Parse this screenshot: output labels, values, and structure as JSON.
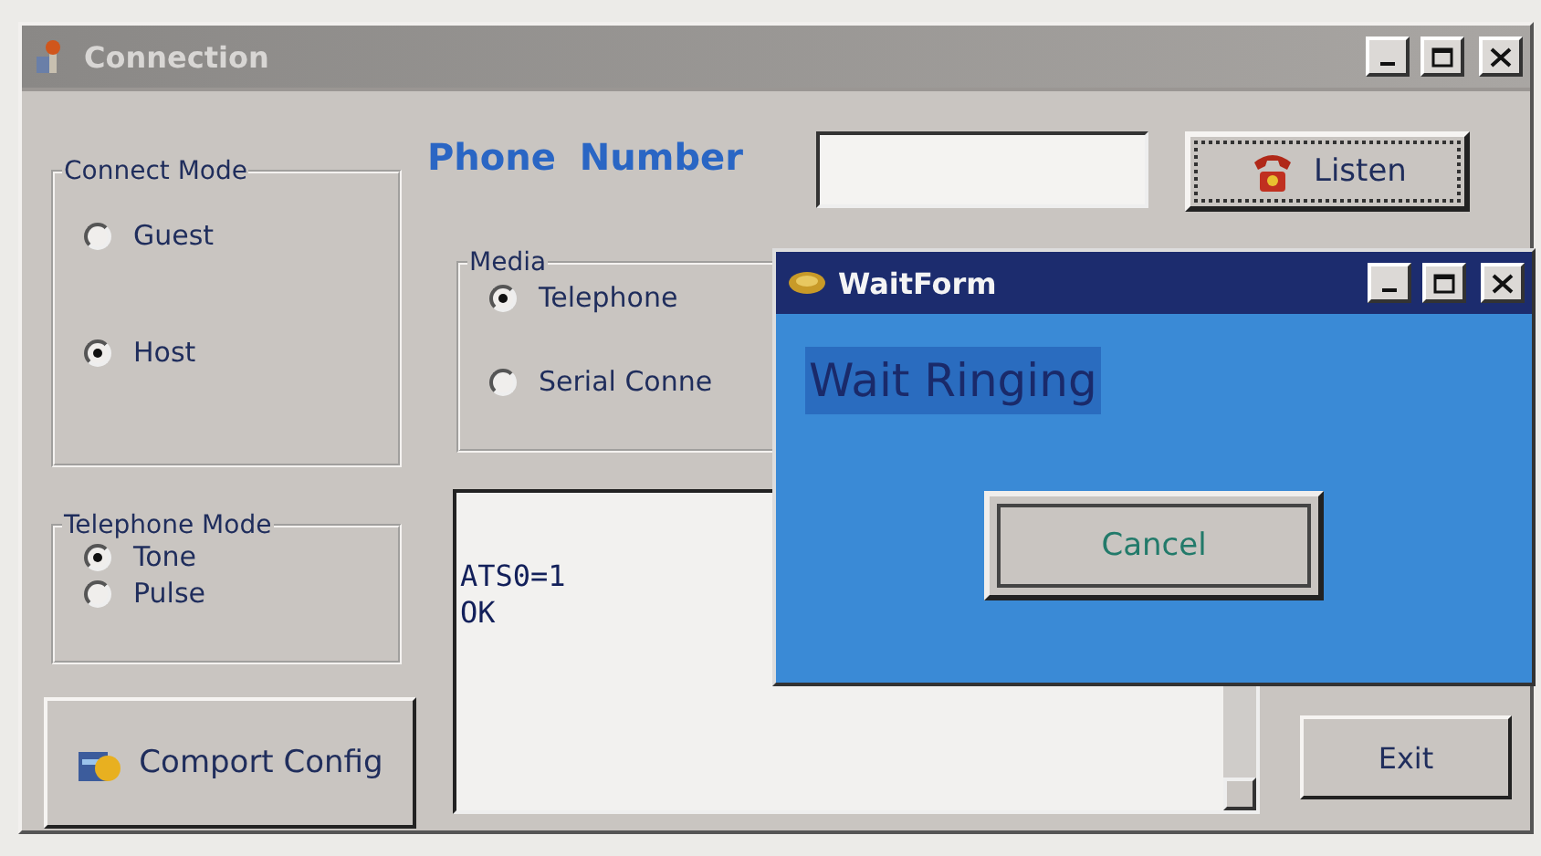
{
  "window": {
    "title": "Connection"
  },
  "phone_number": {
    "label": "Phone Number"
  },
  "listen_button": "Listen",
  "connect_mode": {
    "title": "Connect Mode",
    "options": [
      {
        "label": "Guest",
        "selected": false
      },
      {
        "label": "Host",
        "selected": true
      }
    ]
  },
  "media": {
    "title": "Media",
    "options": [
      {
        "label": "Telephone",
        "selected": true
      },
      {
        "label": "Serial Conne",
        "selected": false
      }
    ]
  },
  "telephone_mode": {
    "title": "Telephone Mode",
    "options": [
      {
        "label": "Tone",
        "selected": true
      },
      {
        "label": "Pulse",
        "selected": false
      }
    ]
  },
  "comport_button": "Comport Config",
  "log": [
    "ATS0=1",
    "OK"
  ],
  "exit_button": "Exit",
  "wait_form": {
    "title": "WaitForm",
    "message": "Wait Ringing",
    "cancel_button": "Cancel"
  }
}
